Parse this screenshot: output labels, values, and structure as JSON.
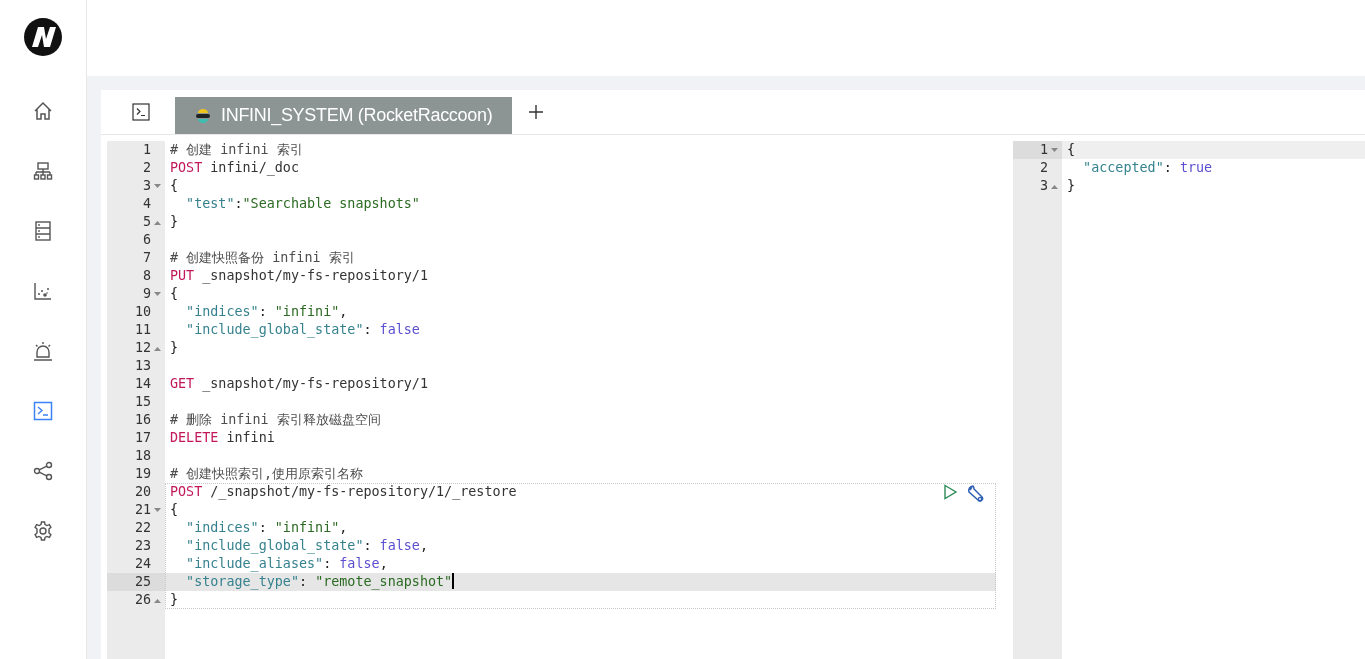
{
  "nav": [
    {
      "kind": "home",
      "selected": false
    },
    {
      "kind": "cluster",
      "selected": false
    },
    {
      "kind": "server",
      "selected": false
    },
    {
      "kind": "scatter",
      "selected": false
    },
    {
      "kind": "alarm",
      "selected": false
    },
    {
      "kind": "terminal",
      "selected": true
    },
    {
      "kind": "share",
      "selected": false
    },
    {
      "kind": "settings",
      "selected": false
    }
  ],
  "tabs": [
    {
      "label": "INFINI_SYSTEM (RocketRaccoon)",
      "selected": true
    }
  ],
  "request_editor": {
    "segments": [
      {
        "selected": false,
        "lines": [
          {
            "number": "1",
            "kind": "plain",
            "active": false,
            "tokens": [
              {
                "kind": "comment",
                "text": "# 创建 infini 索引"
              }
            ]
          },
          {
            "number": "2",
            "kind": "plain",
            "active": false,
            "tokens": [
              {
                "kind": "method",
                "text": "POST"
              },
              {
                "kind": "text",
                "text": " infini/_doc"
              }
            ]
          },
          {
            "number": "3",
            "kind": "fold_start",
            "active": false,
            "tokens": [
              {
                "kind": "punct",
                "text": "{"
              }
            ]
          },
          {
            "number": "4",
            "kind": "plain",
            "active": false,
            "tokens": [
              {
                "kind": "key",
                "text": "  \"test\""
              },
              {
                "kind": "punct",
                "text": ":"
              },
              {
                "kind": "string",
                "text": "\"Searchable snapshots\""
              }
            ]
          },
          {
            "number": "5",
            "kind": "fold_end",
            "active": false,
            "tokens": [
              {
                "kind": "punct",
                "text": "}"
              }
            ]
          },
          {
            "number": "6",
            "kind": "plain",
            "active": false
          },
          {
            "number": "7",
            "kind": "plain",
            "active": false,
            "tokens": [
              {
                "kind": "comment",
                "text": "# 创建快照备份 infini 索引"
              }
            ]
          },
          {
            "number": "8",
            "kind": "plain",
            "active": false,
            "tokens": [
              {
                "kind": "method",
                "text": "PUT"
              },
              {
                "kind": "text",
                "text": " _snapshot/my-fs-repository/1"
              }
            ]
          },
          {
            "number": "9",
            "kind": "fold_start",
            "active": false,
            "tokens": [
              {
                "kind": "punct",
                "text": "{"
              }
            ]
          },
          {
            "number": "10",
            "kind": "plain",
            "active": false,
            "tokens": [
              {
                "kind": "key",
                "text": "  \"indices\""
              },
              {
                "kind": "punct",
                "text": ": "
              },
              {
                "kind": "string",
                "text": "\"infini\""
              },
              {
                "kind": "punct",
                "text": ","
              }
            ]
          },
          {
            "number": "11",
            "kind": "plain",
            "active": false,
            "tokens": [
              {
                "kind": "key",
                "text": "  \"include_global_state\""
              },
              {
                "kind": "punct",
                "text": ": "
              },
              {
                "kind": "boolean",
                "text": "false"
              }
            ]
          },
          {
            "number": "12",
            "kind": "fold_end",
            "active": false,
            "tokens": [
              {
                "kind": "punct",
                "text": "}"
              }
            ]
          },
          {
            "number": "13",
            "kind": "plain",
            "active": false
          },
          {
            "number": "14",
            "kind": "plain",
            "active": false,
            "tokens": [
              {
                "kind": "method",
                "text": "GET"
              },
              {
                "kind": "text",
                "text": " _snapshot/my-fs-repository/1"
              }
            ]
          },
          {
            "number": "15",
            "kind": "plain",
            "active": false
          },
          {
            "number": "16",
            "kind": "plain",
            "active": false,
            "tokens": [
              {
                "kind": "comment",
                "text": "# 删除 infini 索引释放磁盘空间"
              }
            ]
          },
          {
            "number": "17",
            "kind": "plain",
            "active": false,
            "tokens": [
              {
                "kind": "method",
                "text": "DELETE"
              },
              {
                "kind": "text",
                "text": " infini"
              }
            ]
          },
          {
            "number": "18",
            "kind": "plain",
            "active": false
          },
          {
            "number": "19",
            "kind": "plain",
            "active": false,
            "tokens": [
              {
                "kind": "comment",
                "text": "# 创建快照索引,使用原索引名称"
              }
            ]
          }
        ]
      },
      {
        "selected": true,
        "lines": [
          {
            "number": "20",
            "kind": "plain",
            "active": false,
            "tokens": [
              {
                "kind": "method",
                "text": "POST"
              },
              {
                "kind": "text",
                "text": " /_snapshot/my-fs-repository/1/_restore"
              }
            ]
          },
          {
            "number": "21",
            "kind": "fold_start",
            "active": false,
            "tokens": [
              {
                "kind": "punct",
                "text": "{"
              }
            ]
          },
          {
            "number": "22",
            "kind": "plain",
            "active": false,
            "tokens": [
              {
                "kind": "key",
                "text": "  \"indices\""
              },
              {
                "kind": "punct",
                "text": ": "
              },
              {
                "kind": "string",
                "text": "\"infini\""
              },
              {
                "kind": "punct",
                "text": ","
              }
            ]
          },
          {
            "number": "23",
            "kind": "plain",
            "active": false,
            "tokens": [
              {
                "kind": "key",
                "text": "  \"include_global_state\""
              },
              {
                "kind": "punct",
                "text": ": "
              },
              {
                "kind": "boolean",
                "text": "false"
              },
              {
                "kind": "punct",
                "text": ","
              }
            ]
          },
          {
            "number": "24",
            "kind": "plain",
            "active": false,
            "tokens": [
              {
                "kind": "key",
                "text": "  \"include_aliases\""
              },
              {
                "kind": "punct",
                "text": ": "
              },
              {
                "kind": "boolean",
                "text": "false"
              },
              {
                "kind": "punct",
                "text": ","
              }
            ]
          },
          {
            "number": "25",
            "kind": "plain",
            "active": true,
            "tokens": [
              {
                "kind": "key",
                "text": "  \"storage_type\""
              },
              {
                "kind": "punct",
                "text": ": "
              },
              {
                "kind": "string",
                "text": "\"remote_snapshot\""
              }
            ]
          },
          {
            "number": "26",
            "kind": "fold_end",
            "active": false,
            "tokens": [
              {
                "kind": "punct",
                "text": "}"
              }
            ]
          }
        ]
      }
    ]
  },
  "response_viewer": {
    "lines": [
      {
        "number": "1",
        "kind": "fold_start",
        "active": true,
        "tokens": [
          {
            "kind": "punct",
            "text": "{"
          }
        ]
      },
      {
        "number": "2",
        "kind": "plain",
        "active": false,
        "tokens": [
          {
            "kind": "key",
            "text": "  \"accepted\""
          },
          {
            "kind": "punct",
            "text": ": "
          },
          {
            "kind": "boolean",
            "text": "true"
          }
        ]
      },
      {
        "number": "3",
        "kind": "fold_end",
        "active": false,
        "tokens": [
          {
            "kind": "punct",
            "text": "}"
          }
        ]
      }
    ]
  }
}
